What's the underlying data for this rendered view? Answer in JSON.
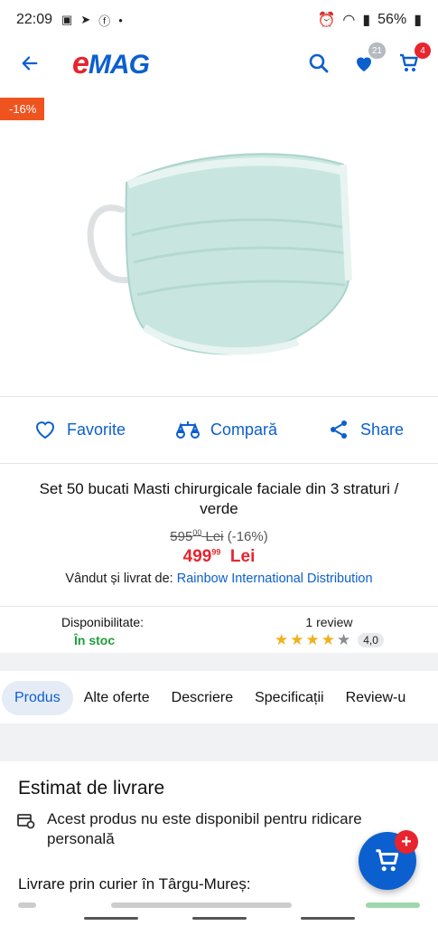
{
  "status_bar": {
    "time": "22:09",
    "battery": "56%"
  },
  "header": {
    "logo_e": "e",
    "logo_rest": "MAG",
    "wishlist_count": "21",
    "cart_count": "4"
  },
  "product": {
    "discount_tag": "-16%",
    "title": "Set 50 bucati Masti chirurgicale faciale din 3 straturi / verde",
    "old_price_int": "595",
    "old_price_dec": "00",
    "old_price_currency": "Lei",
    "old_price_discount": "(-16%)",
    "new_price_int": "499",
    "new_price_dec": "99",
    "new_price_currency": "Lei",
    "seller_label": "Vândut și livrat de:",
    "seller_name": "Rainbow International Distribution"
  },
  "actions": {
    "favorite": "Favorite",
    "compare": "Compară",
    "share": "Share"
  },
  "availability": {
    "label": "Disponibilitate:",
    "value": "În stoc"
  },
  "review": {
    "count_label": "1 review",
    "rating": "4,0",
    "stars_filled": 4,
    "stars_total": 5
  },
  "tabs": [
    {
      "label": "Produs",
      "active": true
    },
    {
      "label": "Alte oferte"
    },
    {
      "label": "Descriere"
    },
    {
      "label": "Specificații"
    },
    {
      "label": "Review-u"
    }
  ],
  "delivery": {
    "title": "Estimat de livrare",
    "pickup_text": "Acest produs nu este disponibil pentru ridicare personală",
    "courier_text": "Livrare prin curier în Târgu-Mureș:"
  },
  "colors": {
    "brand_blue": "#0c5fcf",
    "brand_red": "#e8242d",
    "discount_orange": "#f0541e",
    "stock_green": "#1f9e3c"
  }
}
